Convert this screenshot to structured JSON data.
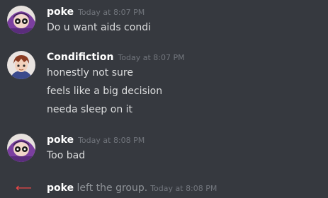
{
  "groups": [
    {
      "author": "poke",
      "timestamp": "Today at 8:07 PM",
      "messages": [
        "Do u want aids condi"
      ]
    },
    {
      "author": "Condifiction",
      "timestamp": "Today at 8:07 PM",
      "messages": [
        "honestly not sure",
        "feels like a big decision",
        "needa sleep on it"
      ]
    },
    {
      "author": "poke",
      "timestamp": "Today at 8:08 PM",
      "messages": [
        "Too bad"
      ]
    }
  ],
  "system_event": {
    "user": "poke",
    "text": " left the group.",
    "timestamp": "Today at 8:08 PM",
    "icon": "leave-arrow-icon"
  },
  "colors": {
    "background": "#36393f",
    "username": "#ffffff",
    "message_text": "#dcddde",
    "timestamp": "#72767d",
    "leave_arrow": "#f04747"
  }
}
